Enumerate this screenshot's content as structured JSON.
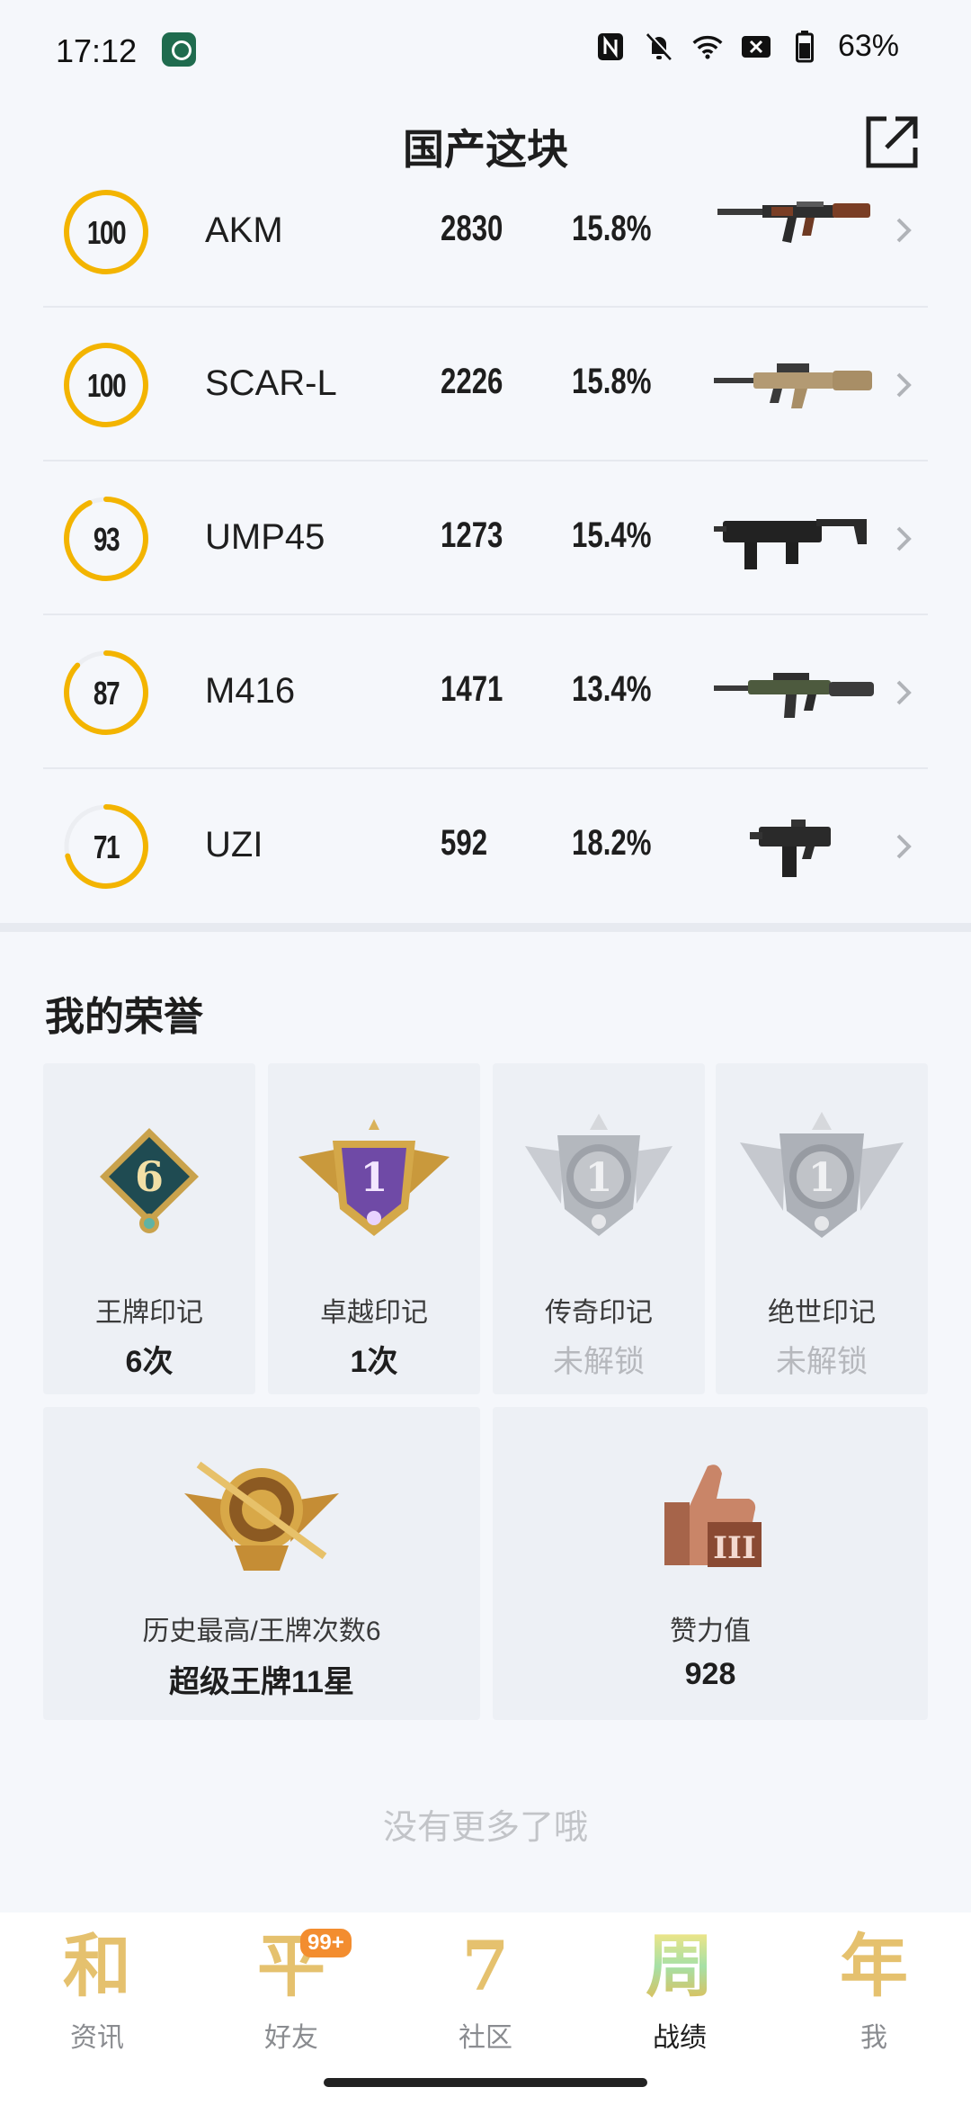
{
  "status_bar": {
    "time": "17:12",
    "battery": "63%",
    "icons": [
      "nfc-icon",
      "mute-bell-icon",
      "wifi-icon",
      "sim-x-icon",
      "battery-icon"
    ]
  },
  "header": {
    "title": "国产这块",
    "share_icon": "external-share-icon"
  },
  "weapons": [
    {
      "score": "100",
      "score_pct": 100,
      "name": "AKM",
      "count": "2830",
      "rate": "15.8%"
    },
    {
      "score": "100",
      "score_pct": 100,
      "name": "SCAR-L",
      "count": "2226",
      "rate": "15.8%"
    },
    {
      "score": "93",
      "score_pct": 93,
      "name": "UMP45",
      "count": "1273",
      "rate": "15.4%"
    },
    {
      "score": "87",
      "score_pct": 87,
      "name": "M416",
      "count": "1471",
      "rate": "13.4%"
    },
    {
      "score": "71",
      "score_pct": 71,
      "name": "UZI",
      "count": "592",
      "rate": "18.2%"
    }
  ],
  "honors": {
    "title": "我的荣誉",
    "marks": [
      {
        "label": "王牌印记",
        "value": "6次",
        "badge_text": "6",
        "locked": false
      },
      {
        "label": "卓越印记",
        "value": "1次",
        "badge_text": "1",
        "locked": false
      },
      {
        "label": "传奇印记",
        "value": "未解锁",
        "badge_text": "1",
        "locked": true
      },
      {
        "label": "绝世印记",
        "value": "未解锁",
        "badge_text": "1",
        "locked": true
      }
    ],
    "highest": {
      "label": "历史最高/王牌次数6",
      "value": "超级王牌11星"
    },
    "likes": {
      "label": "赞力值",
      "value": "928",
      "badge_text": "III"
    }
  },
  "footer_text": "没有更多了哦",
  "nav": {
    "items": [
      {
        "glyph": "和",
        "label": "资讯",
        "active": false
      },
      {
        "glyph": "平",
        "label": "好友",
        "active": false,
        "badge": "99+"
      },
      {
        "glyph": "7",
        "label": "社区",
        "active": false
      },
      {
        "glyph": "周",
        "label": "战绩",
        "active": true
      },
      {
        "glyph": "年",
        "label": "我",
        "active": false
      }
    ]
  },
  "colors": {
    "ring": "#f3b400",
    "ring_track": "#eceef2",
    "nav_gold": "#e5c16e",
    "badge_orange": "#f38d2f"
  }
}
